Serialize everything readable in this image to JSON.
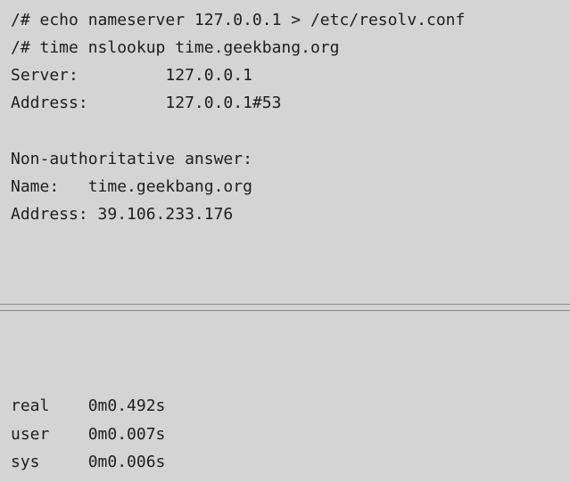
{
  "terminal_top": {
    "lines": [
      "/# echo nameserver 127.0.0.1 > /etc/resolv.conf",
      "/# time nslookup time.geekbang.org",
      "Server:         127.0.0.1",
      "Address:        127.0.0.1#53",
      "",
      "Non-authoritative answer:",
      "Name:   time.geekbang.org",
      "Address: 39.106.233.176"
    ]
  },
  "terminal_bottom": {
    "lines": [
      "real    0m0.492s",
      "user    0m0.007s",
      "sys     0m0.006s"
    ]
  }
}
